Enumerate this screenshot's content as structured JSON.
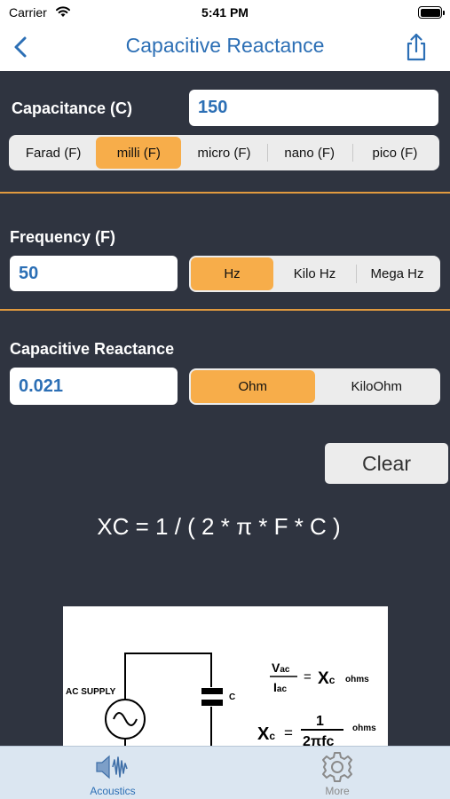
{
  "status_bar": {
    "carrier": "Carrier",
    "time": "5:41 PM"
  },
  "nav": {
    "title": "Capacitive Reactance"
  },
  "capacitance": {
    "label": "Capacitance (C)",
    "value": "150",
    "units": [
      "Farad (F)",
      "milli (F)",
      "micro (F)",
      "nano (F)",
      "pico (F)"
    ],
    "selected_unit": "milli (F)"
  },
  "frequency": {
    "label": "Frequency (F)",
    "value": "50",
    "units": [
      "Hz",
      "Kilo Hz",
      "Mega Hz"
    ],
    "selected_unit": "Hz"
  },
  "reactance": {
    "label": "Capacitive Reactance",
    "value": "0.021",
    "units": [
      "Ohm",
      "KiloOhm"
    ],
    "selected_unit": "Ohm"
  },
  "clear_label": "Clear",
  "formula": "XC = 1 / ( 2 * π * F * C )",
  "diagram": {
    "ac_supply_label": "AC SUPPLY",
    "cap_label": "C",
    "eq1_num": "V",
    "eq1_num_sub": "ac",
    "eq1_den": "I",
    "eq1_den_sub": "ac",
    "eq1_eq": "=",
    "eq1_rhs": "X",
    "eq1_rhs_sub": "c",
    "eq1_unit": "ohms",
    "eq2_lhs": "X",
    "eq2_lhs_sub": "c",
    "eq2_eq": "=",
    "eq2_num": "1",
    "eq2_den": "2πfc",
    "eq2_unit": "ohms"
  },
  "tabs": [
    {
      "label": "Acoustics",
      "icon": "speaker-wave-icon",
      "active": true
    },
    {
      "label": "More",
      "icon": "gear-icon",
      "active": false
    }
  ],
  "colors": {
    "background": "#2f3440",
    "accent": "#f7ad4a",
    "title_blue": "#2c6fb5",
    "divider": "#e19a3f",
    "tab_bar": "#dbe6f1"
  }
}
